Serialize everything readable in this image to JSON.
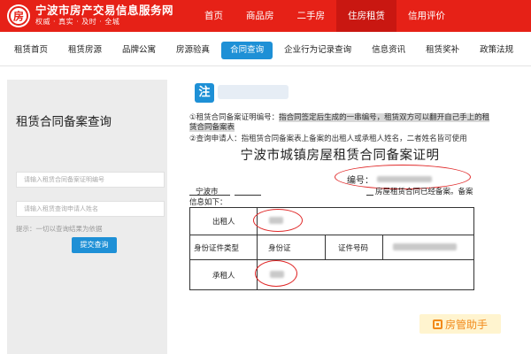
{
  "header": {
    "site_title": "宁波市房产交易信息服务网",
    "slogan": "权威 · 真实 · 及时 · 全城",
    "logo_char": "房",
    "brand_color": "#e62117",
    "nav": [
      {
        "label": "首页",
        "active": false
      },
      {
        "label": "商品房",
        "active": false
      },
      {
        "label": "二手房",
        "active": false
      },
      {
        "label": "住房租赁",
        "active": true
      },
      {
        "label": "信用评价",
        "active": false
      }
    ]
  },
  "subnav": {
    "accent_color": "#1e90d6",
    "items": [
      {
        "label": "租赁首页",
        "active": false
      },
      {
        "label": "租赁房源",
        "active": false
      },
      {
        "label": "品牌公寓",
        "active": false
      },
      {
        "label": "房源验真",
        "active": false
      },
      {
        "label": "合同查询",
        "active": true
      },
      {
        "label": "企业行为记录查询",
        "active": false
      },
      {
        "label": "信息资讯",
        "active": false
      },
      {
        "label": "租赁奖补",
        "active": false
      },
      {
        "label": "政策法规",
        "active": false
      }
    ]
  },
  "query_panel": {
    "title": "租赁合同备案查询",
    "cert_number_placeholder": "请输入租赁合同备案证明编号",
    "applicant_placeholder": "请输入租赁查询申请人姓名",
    "hint": "提示：一切以查询结果为依据",
    "submit_label": "提交查询"
  },
  "note": {
    "badge": "注",
    "line1_prefix": "①租赁合同备案证明编号：",
    "line1_highlight": "指合同签定后生成的一串编号，租赁双方可以翻开自己手上的租赁合同备案表",
    "line2": "②查询申请人：指租赁合同备案表上备案的出租人或承租人姓名，二者姓名皆可使用"
  },
  "certificate": {
    "title": "宁波市城镇房屋租赁合同备案证明",
    "number_label": "编号：",
    "city": "宁波市",
    "body_text": "房屋租赁合同已经备案。备案",
    "info_label": "信息如下：",
    "landlord_label": "出租人",
    "id_type_label": "身份证件类型",
    "id_type_value": "身份证",
    "id_number_label": "证件号码",
    "tenant_label": "承租人",
    "annotation_color": "#e02828"
  },
  "watermark": {
    "text": "房管助手",
    "icon": "app-logo-icon",
    "color": "#f28a1a"
  }
}
